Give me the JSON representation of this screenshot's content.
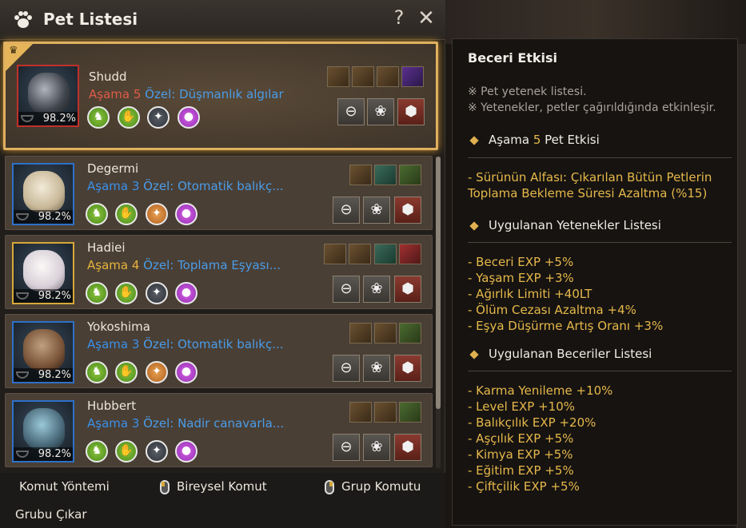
{
  "panel": {
    "title": "Pet Listesi",
    "help_label": "?",
    "close_label": "✕"
  },
  "pets": [
    {
      "name": "Shudd",
      "stage_label": "Aşama 5",
      "special": "Özel: Düşmanlık algılar",
      "percent": "98.2%",
      "frame": "red"
    },
    {
      "name": "Degermi",
      "stage_label": "Aşama 3",
      "special": "Özel: Otomatik balıkç...",
      "percent": "98.2%",
      "frame": "blue"
    },
    {
      "name": "Hadiei",
      "stage_label": "Aşama 4",
      "special": "Özel: Toplama Eşyası...",
      "percent": "98.2%",
      "frame": "gold"
    },
    {
      "name": "Yokoshima",
      "stage_label": "Aşama 3",
      "special": "Özel: Otomatik balıkç...",
      "percent": "98.2%",
      "frame": "blue"
    },
    {
      "name": "Hubbert",
      "stage_label": "Aşama 3",
      "special": "Özel: Nadir canavarla...",
      "percent": "98.2%",
      "frame": "blue"
    }
  ],
  "footer": {
    "command_method": "Komut Yöntemi",
    "individual": "Bireysel Komut",
    "group": "Grup Komutu",
    "remove_group": "Grubu Çıkar"
  },
  "tooltip": {
    "title": "Beceri Etkisi",
    "note1": "※ Pet yetenek listesi.",
    "note2": "※ Yetenekler, petler çağırıldığında etkinleşir.",
    "section1_prefix": "Aşama ",
    "section1_stage": "5",
    "section1_suffix": " Pet Etkisi",
    "effect_line1": "- Sürünün Alfası: Çıkarılan Bütün Petlerin",
    "effect_line2": "Toplama Bekleme Süresi Azaltma (%15)",
    "section2": "Uygulanan Yetenekler Listesi",
    "talents": [
      "- Beceri EXP +5%",
      "- Yaşam EXP +3%",
      "- Ağırlık Limiti +40LT",
      "- Ölüm Cezası Azaltma +4%",
      "- Eşya Düşürme Artış Oranı +3%"
    ],
    "section3": "Uygulanan Beceriler Listesi",
    "skills": [
      "- Karma Yenileme +10%",
      "- Level EXP +10%",
      "- Balıkçılık EXP +20%",
      "- Aşçılık EXP +5%",
      "- Kimya EXP +5%",
      "- Eğitim EXP +5%",
      "- Çiftçilik EXP +5%"
    ]
  },
  "colors": {
    "accent_gold": "#e6b84a",
    "stage_blue": "#3a90e8",
    "stage_red": "#e05a48",
    "frame_highlight": "#e0b060"
  }
}
